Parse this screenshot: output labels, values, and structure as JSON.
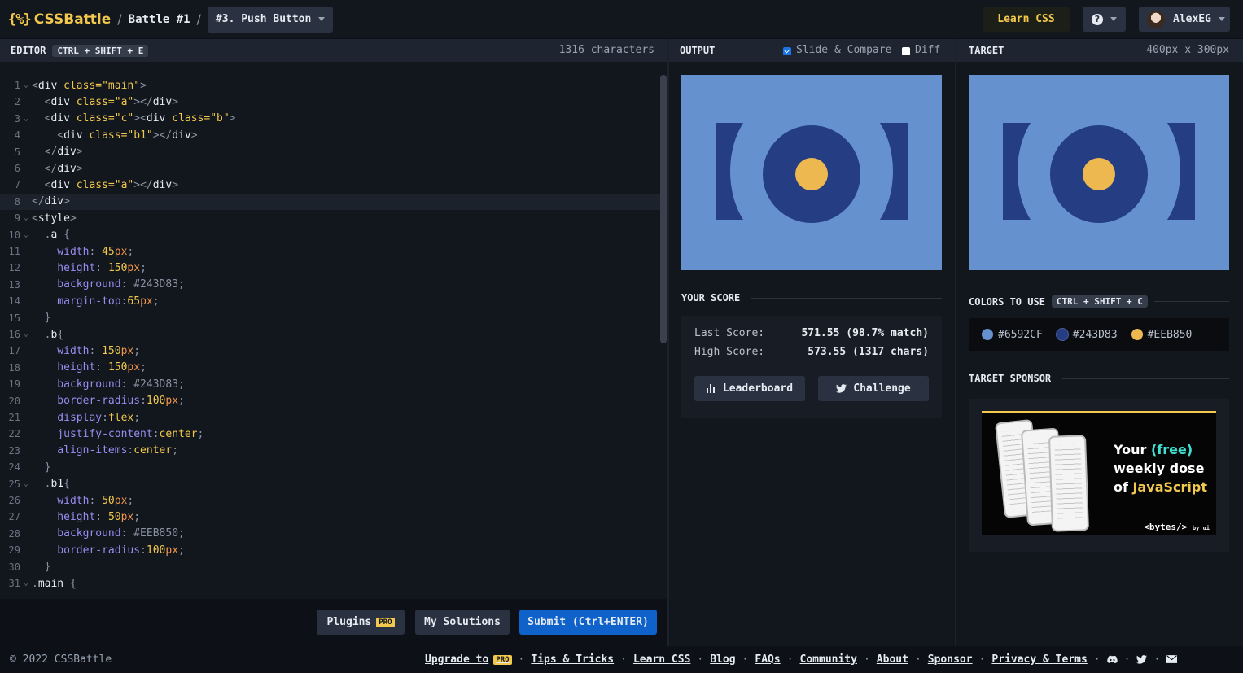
{
  "header": {
    "brand": "CSSBattle",
    "brand_mark": "{%}",
    "sep": "/",
    "battle": "Battle #1",
    "target_name": "#3. Push Button",
    "learn_css": "Learn CSS",
    "help": "?",
    "user": "AlexEG"
  },
  "editor": {
    "title": "EDITOR",
    "shortcut": "CTRL + SHIFT + E",
    "char_count": "1316 characters",
    "lines": [
      {
        "n": "1",
        "fold": true
      },
      {
        "n": "2"
      },
      {
        "n": "3",
        "fold": true
      },
      {
        "n": "4"
      },
      {
        "n": "5"
      },
      {
        "n": "6"
      },
      {
        "n": "7"
      },
      {
        "n": "8"
      },
      {
        "n": "9",
        "fold": true
      },
      {
        "n": "10",
        "fold": true
      },
      {
        "n": "11"
      },
      {
        "n": "12"
      },
      {
        "n": "13"
      },
      {
        "n": "14"
      },
      {
        "n": "15"
      },
      {
        "n": "16",
        "fold": true
      },
      {
        "n": "17"
      },
      {
        "n": "18"
      },
      {
        "n": "19"
      },
      {
        "n": "20"
      },
      {
        "n": "21"
      },
      {
        "n": "22"
      },
      {
        "n": "23"
      },
      {
        "n": "24"
      },
      {
        "n": "25",
        "fold": true
      },
      {
        "n": "26"
      },
      {
        "n": "27"
      },
      {
        "n": "28"
      },
      {
        "n": "29"
      },
      {
        "n": "30"
      },
      {
        "n": "31",
        "fold": true
      }
    ],
    "code": {
      "l1": [
        "<",
        "div",
        " class=",
        "\"main\"",
        ">"
      ],
      "l2": [
        "  <",
        "div",
        " class=",
        "\"a\"",
        "></",
        "div",
        ">"
      ],
      "l3": [
        "  <",
        "div",
        " class=",
        "\"c\"",
        "><",
        "div",
        " class=",
        "\"b\"",
        ">"
      ],
      "l4": [
        "    <",
        "div",
        " class=",
        "\"b1\"",
        "></",
        "div",
        ">"
      ],
      "l5": [
        "  </",
        "div",
        ">"
      ],
      "l6": [
        "  </",
        "div",
        ">"
      ],
      "l7": [
        "  <",
        "div",
        " class=",
        "\"a\"",
        "></",
        "div",
        ">"
      ],
      "l8": [
        "</",
        "div",
        ">"
      ],
      "l9": [
        "<",
        "style",
        ">"
      ],
      "l10": [
        "  .",
        "a",
        " {"
      ],
      "l11": [
        "    width",
        ": ",
        "45",
        "px",
        ";"
      ],
      "l12": [
        "    height",
        ": ",
        "150",
        "px",
        ";"
      ],
      "l13": [
        "    background",
        ": ",
        "#243D83",
        ";"
      ],
      "l14": [
        "    margin-top",
        ":",
        "65",
        "px",
        ";"
      ],
      "l15": [
        "  }"
      ],
      "l16": [
        "  .",
        "b",
        "{"
      ],
      "l17": [
        "    width",
        ": ",
        "150",
        "px",
        ";"
      ],
      "l18": [
        "    height",
        ": ",
        "150",
        "px",
        ";"
      ],
      "l19": [
        "    background",
        ": ",
        "#243D83",
        ";"
      ],
      "l20": [
        "    border-radius",
        ":",
        "100",
        "px",
        ";"
      ],
      "l21": [
        "    display",
        ":",
        "flex",
        ";"
      ],
      "l22": [
        "    justify-content",
        ":",
        "center",
        ";"
      ],
      "l23": [
        "    align-items",
        ":",
        "center",
        ";"
      ],
      "l24": [
        "  }"
      ],
      "l25": [
        "  .",
        "b1",
        "{"
      ],
      "l26": [
        "    width",
        ": ",
        "50",
        "px",
        ";"
      ],
      "l27": [
        "    height",
        ": ",
        "50",
        "px",
        ";"
      ],
      "l28": [
        "    background",
        ": ",
        "#EEB850",
        ";"
      ],
      "l29": [
        "    border-radius",
        ":",
        "100",
        "px",
        ";"
      ],
      "l30": [
        "  }"
      ],
      "l31": [
        ".",
        "main",
        " {"
      ]
    },
    "buttons": {
      "plugins": "Plugins",
      "pro": "PRO",
      "solutions": "My Solutions",
      "submit": "Submit (Ctrl+ENTER)"
    }
  },
  "output": {
    "title": "OUTPUT",
    "slide_compare": "Slide & Compare",
    "slide_compare_checked": true,
    "diff": "Diff",
    "diff_checked": false
  },
  "score": {
    "title": "YOUR SCORE",
    "last_label": "Last Score:",
    "last_value": "571.55 (98.7% match)",
    "high_label": "High Score:",
    "high_value": "573.55 (1317 chars)",
    "leaderboard": "Leaderboard",
    "challenge": "Challenge"
  },
  "target": {
    "title": "TARGET",
    "size": "400px x 300px",
    "colors_title": "COLORS TO USE",
    "colors_shortcut": "CTRL + SHIFT + C",
    "colors": [
      "#6592CF",
      "#243D83",
      "#EEB850"
    ],
    "sponsor_title": "TARGET SPONSOR",
    "ad": {
      "line1_a": "Your ",
      "line1_b": "(free)",
      "line2": "weekly dose",
      "line3_a": "of ",
      "line3_b": "JavaScript",
      "bytes": "<bytes/>",
      "bytes_by": "by ui"
    }
  },
  "footer": {
    "copyright": "© 2022 CSSBattle",
    "upgrade": "Upgrade to",
    "pro": "PRO",
    "links": [
      "Tips & Tricks",
      "Learn CSS",
      "Blog",
      "FAQs",
      "Community",
      "About",
      "Sponsor",
      "Privacy & Terms"
    ],
    "sep": "·"
  },
  "icons": {
    "fold": "chevron-down-icon",
    "help": "question-icon",
    "leaderboard": "bar-chart-icon",
    "challenge": "twitter-icon",
    "discord": "discord-icon",
    "twitter": "twitter-icon",
    "mail": "mail-icon"
  },
  "colors_meta": {
    "accent": "#F2C94C",
    "submit": "#0F62C9"
  }
}
